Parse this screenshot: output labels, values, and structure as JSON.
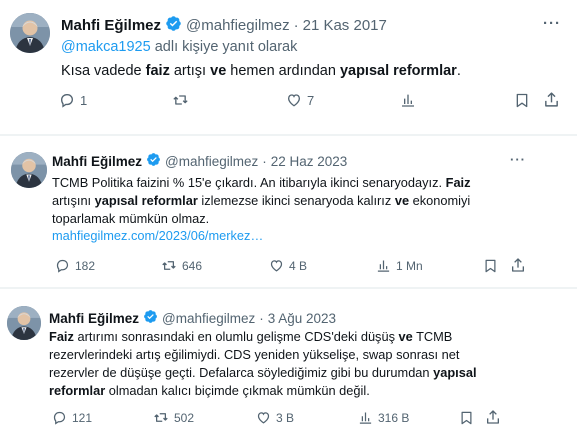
{
  "tweets": [
    {
      "author": "Mahfi Eğilmez",
      "handle": "@mahfiegilmez",
      "separator": "·",
      "date": "21 Kas 2017",
      "reply_mention": "@makca1925",
      "reply_suffix": " adlı kişiye yanıt olarak",
      "text": [
        {
          "t": "Kısa vadede "
        },
        {
          "t": "faiz",
          "b": true
        },
        {
          "t": " artışı "
        },
        {
          "t": "ve",
          "b": true
        },
        {
          "t": " hemen ardından "
        },
        {
          "t": "yapısal reformlar",
          "b": true
        },
        {
          "t": "."
        }
      ],
      "replies": "1",
      "retweets": "",
      "likes": "7",
      "views": ""
    },
    {
      "author": "Mahfi Eğilmez",
      "handle": "@mahfiegilmez",
      "separator": "·",
      "date": "22 Haz 2023",
      "text": [
        {
          "t": "TCMB Politika faizini % 15'e çıkardı. An itibarıyla ikinci senaryodayız. "
        },
        {
          "t": "Faiz",
          "b": true
        },
        {
          "t": " artışını "
        },
        {
          "t": "yapısal reformlar",
          "b": true
        },
        {
          "t": " izlemezse ikinci senaryoda kalırız "
        },
        {
          "t": "ve",
          "b": true
        },
        {
          "t": " ekonomiyi toparlamak mümkün olmaz."
        }
      ],
      "link": "mahfiegilmez.com/2023/06/merkez…",
      "replies": "182",
      "retweets": "646",
      "likes": "4 B",
      "views": "1 Mn"
    },
    {
      "author": "Mahfi Eğilmez",
      "handle": "@mahfiegilmez",
      "separator": "·",
      "date": "3 Ağu 2023",
      "text": [
        {
          "t": "Faiz",
          "b": true
        },
        {
          "t": " artırımı sonrasındaki en olumlu gelişme CDS'deki düşüş "
        },
        {
          "t": "ve",
          "b": true
        },
        {
          "t": " TCMB rezervlerindeki artış eğilimiydi. CDS yeniden yükselişe, swap sonrası net rezervler de düşüşe geçti. Defalarca söylediğimiz gibi bu durumdan "
        },
        {
          "t": "yapısal reformlar",
          "b": true
        },
        {
          "t": " olmadan kalıcı biçimde çıkmak mümkün değil."
        }
      ],
      "replies": "121",
      "retweets": "502",
      "likes": "3 B",
      "views": "316 B"
    }
  ],
  "more_glyph": "···",
  "colors": {
    "text": "#0f1419",
    "muted": "#536471",
    "link": "#1d9bf0",
    "verified": "#1d9bf0"
  }
}
